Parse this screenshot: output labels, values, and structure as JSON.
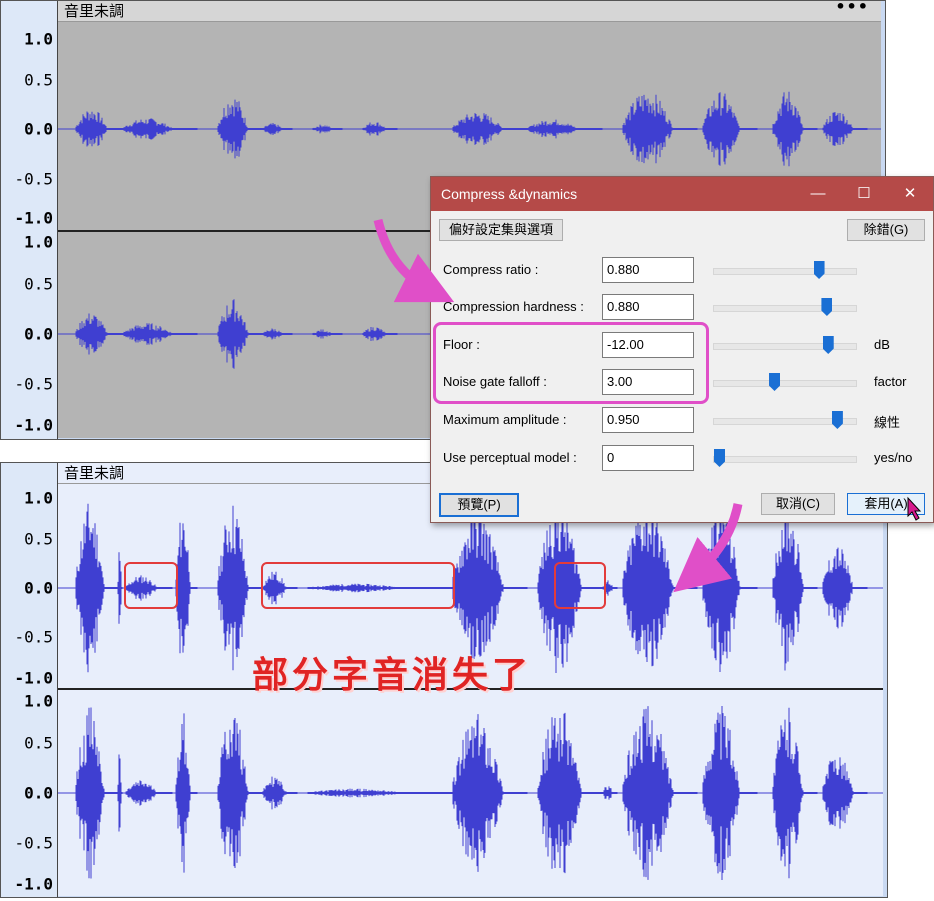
{
  "top_panel": {
    "track_name": "音里未調",
    "menu_dots": "•••",
    "ruler_upper": [
      "1.0",
      "0.5",
      "0.0",
      "-0.5",
      "-1.0"
    ],
    "ruler_lower": [
      "1.0",
      "0.5",
      "0.0",
      "-0.5",
      "-1.0"
    ]
  },
  "bottom_panel": {
    "track_name": "音里未調",
    "ruler_upper": [
      "1.0",
      "0.5",
      "0.0",
      "-0.5",
      "-1.0"
    ],
    "ruler_lower": [
      "1.0",
      "0.5",
      "0.0",
      "-0.5",
      "-1.0"
    ]
  },
  "dialog": {
    "title": "Compress &dynamics",
    "minimize": "—",
    "maximize": "☐",
    "close": "✕",
    "preset_button": "偏好設定集與選項",
    "debug_button": "除錯(G)",
    "params": [
      {
        "label": "Compress ratio :",
        "value": "0.880",
        "unit": "",
        "slider": 0.76
      },
      {
        "label": "Compression hardness :",
        "value": "0.880",
        "unit": "",
        "slider": 0.82
      },
      {
        "label": "Floor :",
        "value": "-12.00",
        "unit": "dB",
        "slider": 0.83
      },
      {
        "label": "Noise gate falloff :",
        "value": "3.00",
        "unit": "factor",
        "slider": 0.42
      },
      {
        "label": "Maximum amplitude :",
        "value": "0.950",
        "unit": "線性",
        "slider": 0.9
      },
      {
        "label": "Use perceptual model :",
        "value": "0",
        "unit": "yes/no",
        "slider": 0.0
      }
    ],
    "preview_button": "預覽(P)",
    "cancel_button": "取消(C)",
    "apply_button": "套用(A)"
  },
  "annotation_text": "部分字音消失了",
  "colors": {
    "wave": "#3f3fd1",
    "top_bg": "#b4b4b4",
    "bottom_bg": "#e8eefb",
    "dialog_title": "#b54a48",
    "highlight": "#e04fc8",
    "red": "#e23b3b"
  }
}
